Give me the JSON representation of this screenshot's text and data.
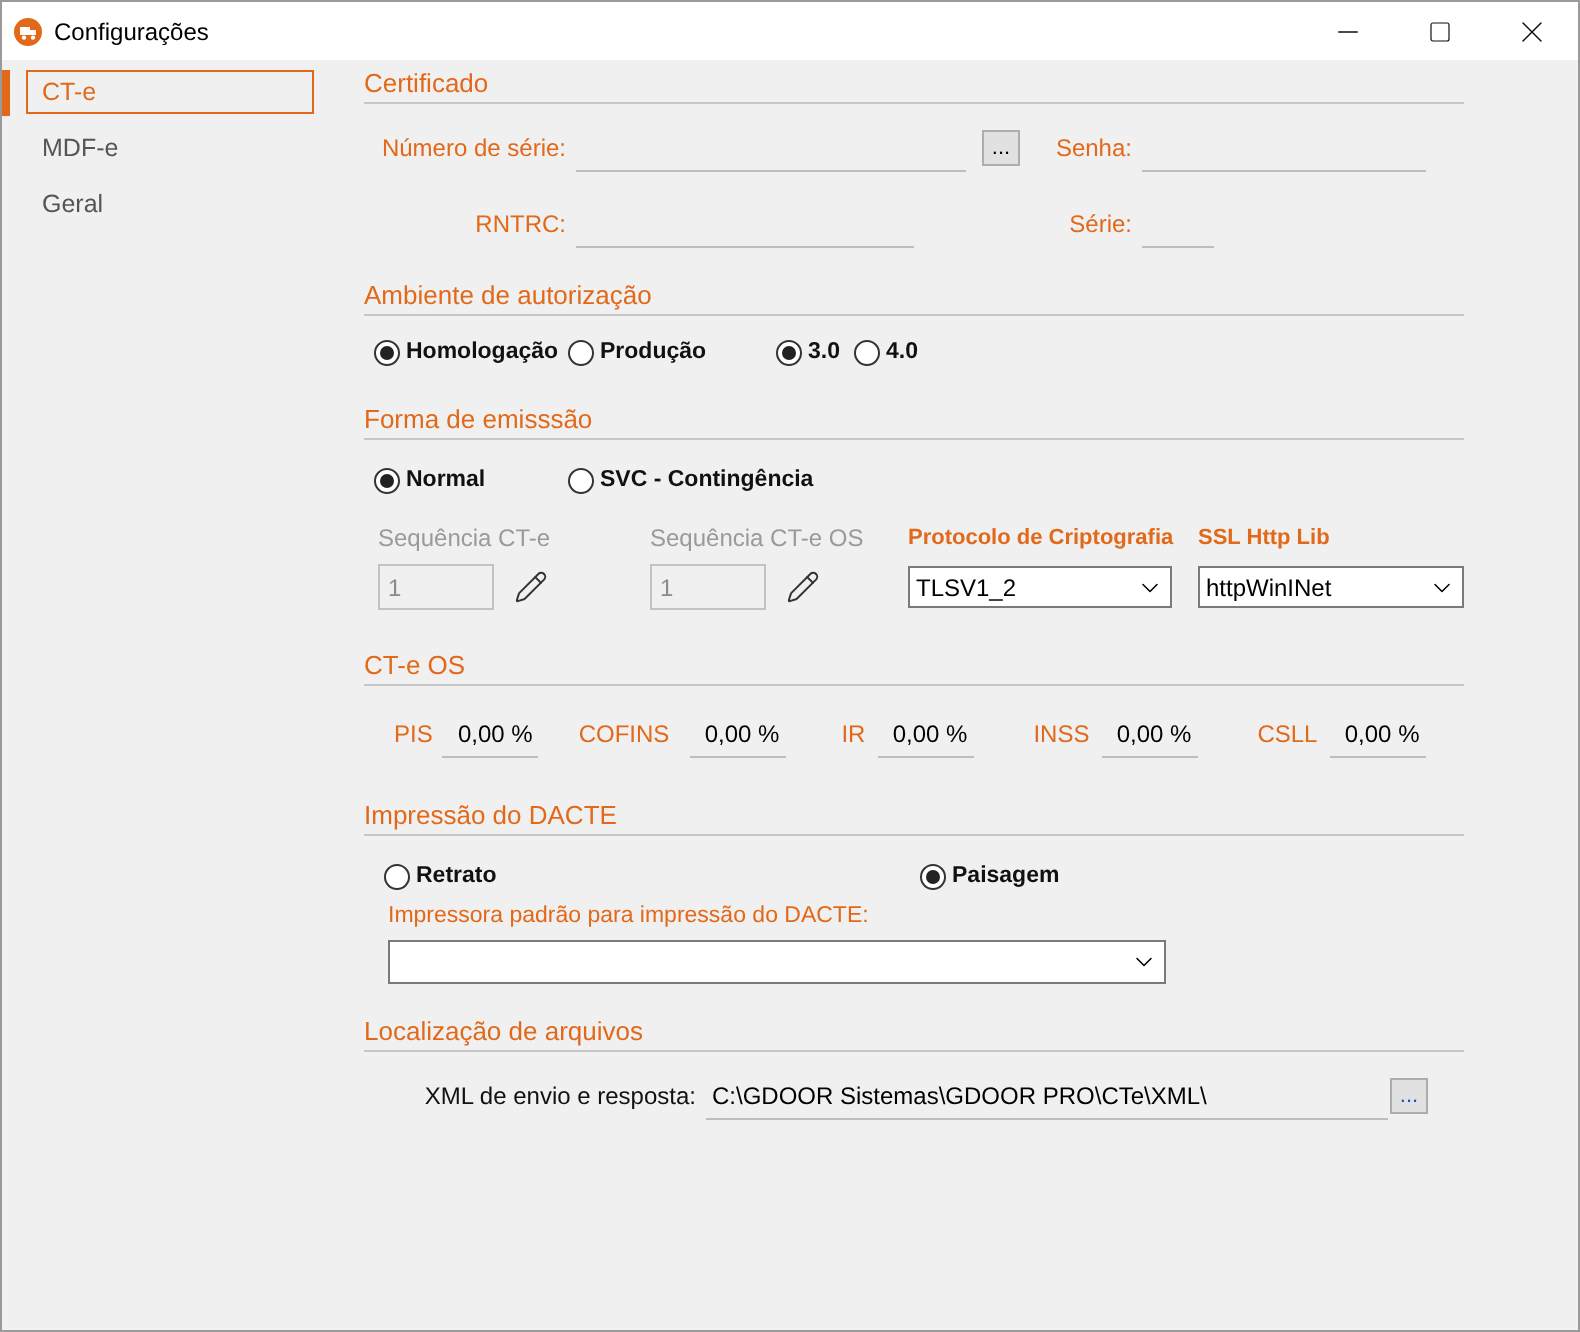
{
  "window": {
    "title": "Configurações"
  },
  "sidebar": {
    "items": [
      {
        "label": "CT-e",
        "selected": true
      },
      {
        "label": "MDF-e",
        "selected": false
      },
      {
        "label": "Geral",
        "selected": false
      }
    ]
  },
  "certificado": {
    "title": "Certificado",
    "serial_label": "Número de série:",
    "browse_button": "...",
    "password_label": "Senha:",
    "rntrc_label": "RNTRC:",
    "series_label": "Série:"
  },
  "ambiente": {
    "title": "Ambiente de autorização",
    "environment": [
      {
        "label": "Homologação",
        "selected": true
      },
      {
        "label": "Produção",
        "selected": false
      }
    ],
    "version": [
      {
        "label": "3.0",
        "selected": true
      },
      {
        "label": "4.0",
        "selected": false
      }
    ]
  },
  "emissao": {
    "title": "Forma de emisssão",
    "modes": [
      {
        "label": "Normal",
        "selected": true
      },
      {
        "label": "SVC - Contingência",
        "selected": false
      }
    ],
    "sequences": [
      {
        "label": "Sequência CT-e",
        "value": "1",
        "disabled": true
      },
      {
        "label": "Sequência CT-e OS",
        "value": "1",
        "disabled": true
      }
    ],
    "protocol": {
      "label": "Protocolo de Criptografia",
      "value": "TLSV1_2"
    },
    "ssl_lib": {
      "label": "SSL Http Lib",
      "value": "httpWinINet"
    }
  },
  "cte_os": {
    "title": "CT-e OS",
    "taxes": [
      {
        "label": "PIS",
        "value": "0,00 %"
      },
      {
        "label": "COFINS",
        "value": "0,00 %"
      },
      {
        "label": "IR",
        "value": "0,00 %"
      },
      {
        "label": "INSS",
        "value": "0,00 %"
      },
      {
        "label": "CSLL",
        "value": "0,00 %"
      }
    ]
  },
  "dacte": {
    "title": "Impressão do DACTE",
    "orientation": [
      {
        "label": "Retrato",
        "selected": false
      },
      {
        "label": "Paisagem",
        "selected": true
      }
    ],
    "printer_label": "Impressora padrão para impressão do DACTE:"
  },
  "arquivos": {
    "title": "Localização de arquivos",
    "xml_label": "XML de envio e resposta:",
    "xml_value": "C:\\GDOOR Sistemas\\GDOOR PRO\\CTe\\XML\\",
    "browse_button": "..."
  }
}
